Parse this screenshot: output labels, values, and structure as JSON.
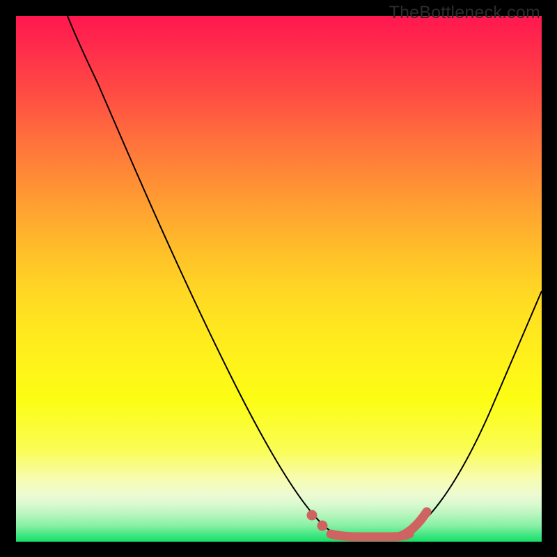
{
  "watermark": "TheBottleneck.com",
  "colors": {
    "curve_stroke": "#000000",
    "optimal_stroke": "#cf6361",
    "optimal_dot": "#cf6361"
  },
  "chart_data": {
    "type": "line",
    "title": "",
    "xlabel": "",
    "ylabel": "",
    "xlim": [
      0,
      100
    ],
    "ylim": [
      0,
      100
    ],
    "grid": false,
    "series": [
      {
        "name": "bottleneck-curve-left",
        "x": [
          10,
          15,
          20,
          25,
          30,
          35,
          40,
          45,
          50,
          54,
          58,
          62
        ],
        "values": [
          100,
          90,
          79,
          67,
          55,
          44,
          33,
          22,
          13,
          6,
          2,
          0.5
        ]
      },
      {
        "name": "bottleneck-curve-right",
        "x": [
          72,
          76,
          80,
          84,
          88,
          92,
          96,
          100
        ],
        "values": [
          0.5,
          4,
          10,
          18,
          27,
          36,
          45,
          54
        ]
      },
      {
        "name": "optimal-plateau",
        "x": [
          62,
          64,
          66,
          68,
          70,
          72
        ],
        "values": [
          0.5,
          0.3,
          0.3,
          0.3,
          0.3,
          0.5
        ]
      }
    ],
    "optimal_markers": {
      "left_dots_x": [
        56.5,
        58.5
      ],
      "plateau_x_range": [
        60,
        72
      ],
      "right_thick_x_range": [
        72,
        76.5
      ]
    }
  }
}
